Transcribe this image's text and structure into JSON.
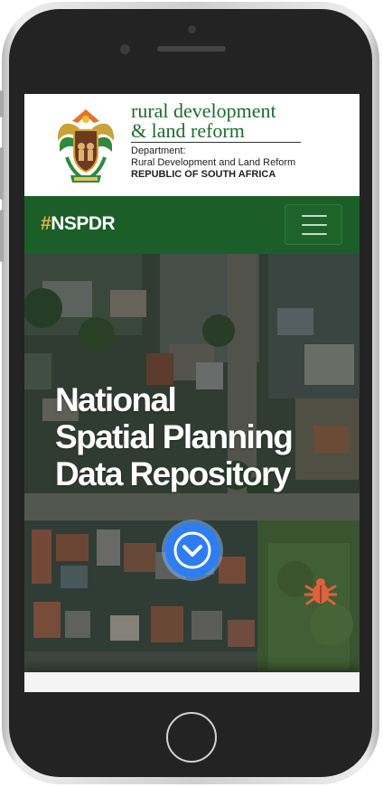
{
  "header": {
    "logo_icon": "coat-of-arms-icon",
    "brand_line1": "rural development",
    "brand_line2": "& land reform",
    "dept_line1": "Department:",
    "dept_line2": "Rural Development and Land Reform",
    "dept_line3": "REPUBLIC OF SOUTH AFRICA"
  },
  "navbar": {
    "brand_hash": "#",
    "brand_text": "NSPDR",
    "menu_icon": "hamburger-icon"
  },
  "hero": {
    "title_line1": "National",
    "title_line2": "Spatial Planning",
    "title_line3": "Data Repository",
    "scroll_icon": "chevron-down-icon",
    "bug_icon": "bug-icon"
  },
  "colors": {
    "brand_green": "#1b5e27",
    "brand_gold": "#e6b73a",
    "scroll_button_blue": "#2f7df2",
    "bug_orange": "#e0613d"
  }
}
